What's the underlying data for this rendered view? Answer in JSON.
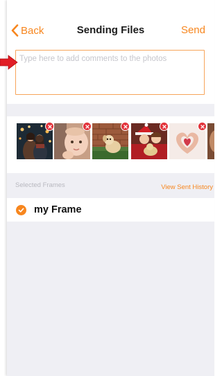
{
  "nav": {
    "back_label": "Back",
    "title": "Sending Files",
    "send_label": "Send"
  },
  "comment": {
    "placeholder": "Type here to add comments to the photos",
    "value": ""
  },
  "photos": [
    {
      "subject": "couple-at-night"
    },
    {
      "subject": "baby-closeup"
    },
    {
      "subject": "puppy-on-brick-steps"
    },
    {
      "subject": "kids-with-santa-hat-and-dog"
    },
    {
      "subject": "heart-shaped-hands"
    },
    {
      "subject": "portrait-partial"
    }
  ],
  "frames": {
    "section_label": "Selected Frames",
    "history_link": "View Sent History",
    "items": [
      {
        "name": "my Frame",
        "selected": true
      }
    ]
  },
  "colors": {
    "accent": "#f7861e",
    "callout": "#e11d24",
    "remove_badge": "#e2323a",
    "background": "#efeff4"
  }
}
